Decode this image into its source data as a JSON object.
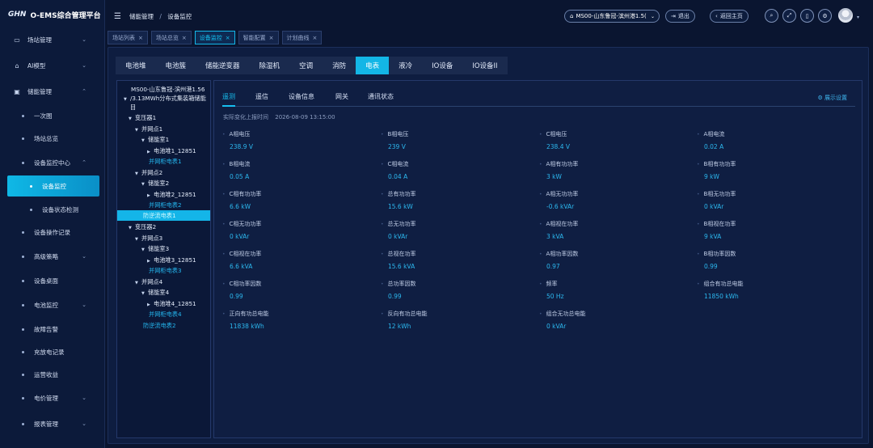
{
  "app": {
    "logo_mark": "GHN",
    "title": "O-EMS综合管理平台"
  },
  "sidebar": {
    "items": [
      {
        "label": "场站管理",
        "icon": "monitor-icon",
        "expanded": false
      },
      {
        "label": "AI模型",
        "icon": "chip-icon",
        "expanded": false
      },
      {
        "label": "储能管理",
        "icon": "storage-icon",
        "expanded": true
      },
      {
        "label": "一次图"
      },
      {
        "label": "场站总览"
      },
      {
        "label": "设备监控中心",
        "expanded": true
      },
      {
        "label": "设备监控"
      },
      {
        "label": "设备状态检测"
      },
      {
        "label": "设备操作记录"
      },
      {
        "label": "高级策略"
      },
      {
        "label": "设备桌面"
      },
      {
        "label": "电池监控"
      },
      {
        "label": "故障告警"
      },
      {
        "label": "充放电记录"
      },
      {
        "label": "运营收益"
      },
      {
        "label": "电价管理"
      },
      {
        "label": "报表管理"
      }
    ]
  },
  "header": {
    "breadcrumb": [
      "储能管理",
      "设备监控"
    ],
    "station": "MS00-山东鲁冠-滨州港1.5(",
    "logout": "退出",
    "home": "返回主页"
  },
  "page_tabs": [
    {
      "label": "场站列表"
    },
    {
      "label": "场站总览"
    },
    {
      "label": "设备监控",
      "active": true
    },
    {
      "label": "智能配置"
    },
    {
      "label": "计划曲线"
    }
  ],
  "device_tabs": [
    "电池堆",
    "电池簇",
    "储能逆变器",
    "除湿机",
    "空调",
    "消防",
    "电表",
    "液冷",
    "IO设备",
    "IO设备II"
  ],
  "active_device_tab": "电表",
  "tree": {
    "root": "MS00-山东鲁冠-滨州港1.56",
    "sub": "/3.13MWh分布式集装箱储能",
    "sub2": "目",
    "nodes": [
      "变压器1",
      "并网点1",
      "储能室1",
      "电池堆1_12851",
      "并网柜电表1",
      "并网点2",
      "储能室2",
      "电池堆2_12851",
      "并网柜电表2",
      "防逆流电表1",
      "变压器2",
      "并网点3",
      "储能室3",
      "电池堆3_12851",
      "并网柜电表3",
      "并网点4",
      "储能室4",
      "电池堆4_12851",
      "并网柜电表4",
      "防逆流电表2"
    ]
  },
  "sub_tabs": [
    "遥测",
    "遥信",
    "设备信息",
    "网关",
    "通讯状态"
  ],
  "display_settings": "展示设置",
  "report": {
    "label": "实际变化上报时间",
    "time": "2026-08-09 13:15:00"
  },
  "metrics": [
    {
      "label": "A相电压",
      "value": "238.9 V"
    },
    {
      "label": "B相电压",
      "value": "239 V"
    },
    {
      "label": "C相电压",
      "value": "238.4 V"
    },
    {
      "label": "A相电流",
      "value": "0.02 A"
    },
    {
      "label": "B相电流",
      "value": "0.05 A"
    },
    {
      "label": "C相电流",
      "value": "0.04 A"
    },
    {
      "label": "A相有功功率",
      "value": "3 kW"
    },
    {
      "label": "B相有功功率",
      "value": "9 kW"
    },
    {
      "label": "C相有功功率",
      "value": "6.6 kW"
    },
    {
      "label": "总有功功率",
      "value": "15.6 kW"
    },
    {
      "label": "A相无功功率",
      "value": "-0.6 kVAr"
    },
    {
      "label": "B相无功功率",
      "value": "0 kVAr"
    },
    {
      "label": "C相无功功率",
      "value": "0 kVAr"
    },
    {
      "label": "总无功功率",
      "value": "0 kVAr"
    },
    {
      "label": "A相视在功率",
      "value": "3 kVA"
    },
    {
      "label": "B相视在功率",
      "value": "9 kVA"
    },
    {
      "label": "C相视在功率",
      "value": "6.6 kVA"
    },
    {
      "label": "总视在功率",
      "value": "15.6 kVA"
    },
    {
      "label": "A相功率因数",
      "value": "0.97"
    },
    {
      "label": "B相功率因数",
      "value": "0.99"
    },
    {
      "label": "C相功率因数",
      "value": "0.99"
    },
    {
      "label": "总功率因数",
      "value": "0.99"
    },
    {
      "label": "频率",
      "value": "50 Hz"
    },
    {
      "label": "组合有功总电能",
      "value": "11850 kWh"
    },
    {
      "label": "正向有功总电能",
      "value": "11838 kWh"
    },
    {
      "label": "反向有功总电能",
      "value": "12 kWh"
    },
    {
      "label": "组合无功总电能",
      "value": "0 kVAr"
    }
  ]
}
